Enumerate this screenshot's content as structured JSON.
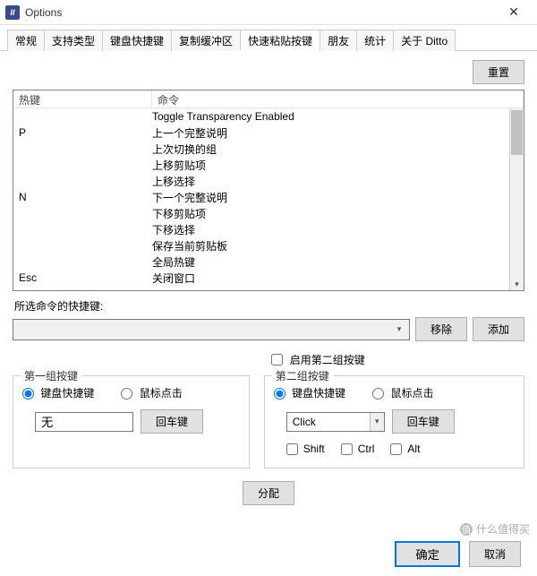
{
  "window": {
    "title": "Options"
  },
  "tabs": {
    "t0": "常规",
    "t1": "支持类型",
    "t2": "键盘快捷键",
    "t3": "复制缓冲区",
    "t4": "快速粘贴按键",
    "t5": "朋友",
    "t6": "统计",
    "t7": "关于 Ditto"
  },
  "buttons": {
    "reset": "重置",
    "remove": "移除",
    "add": "添加",
    "enter": "回车键",
    "assign": "分配",
    "ok": "确定",
    "cancel": "取消"
  },
  "list": {
    "header_hotkey": "热键",
    "header_command": "命令",
    "rows": {
      "r0": {
        "hot": "",
        "cmd": "Toggle Transparency Enabled"
      },
      "r1": {
        "hot": "P",
        "cmd": "上一个完整说明"
      },
      "r2": {
        "hot": "",
        "cmd": "上次切换的组"
      },
      "r3": {
        "hot": "",
        "cmd": "上移剪贴项"
      },
      "r4": {
        "hot": "",
        "cmd": "上移选择"
      },
      "r5": {
        "hot": "N",
        "cmd": "下一个完整说明"
      },
      "r6": {
        "hot": "",
        "cmd": "下移剪贴项"
      },
      "r7": {
        "hot": "",
        "cmd": "下移选择"
      },
      "r8": {
        "hot": "",
        "cmd": "保存当前剪贴板"
      },
      "r9": {
        "hot": "",
        "cmd": "全局热键"
      },
      "r10": {
        "hot": "Esc",
        "cmd": "关闭窗口"
      }
    }
  },
  "labels": {
    "selected_hotkey": "所选命令的快捷键:",
    "enable_group2": "启用第二组按键",
    "group1": "第一组按键",
    "group2": "第二组按键",
    "kb_shortcut": "键盘快捷键",
    "mouse_click": "鼠标点击",
    "shift": "Shift",
    "ctrl": "Ctrl",
    "alt": "Alt"
  },
  "fields": {
    "group1_key": "无",
    "group2_click": "Click"
  },
  "watermark": {
    "text": "什么值得买"
  }
}
